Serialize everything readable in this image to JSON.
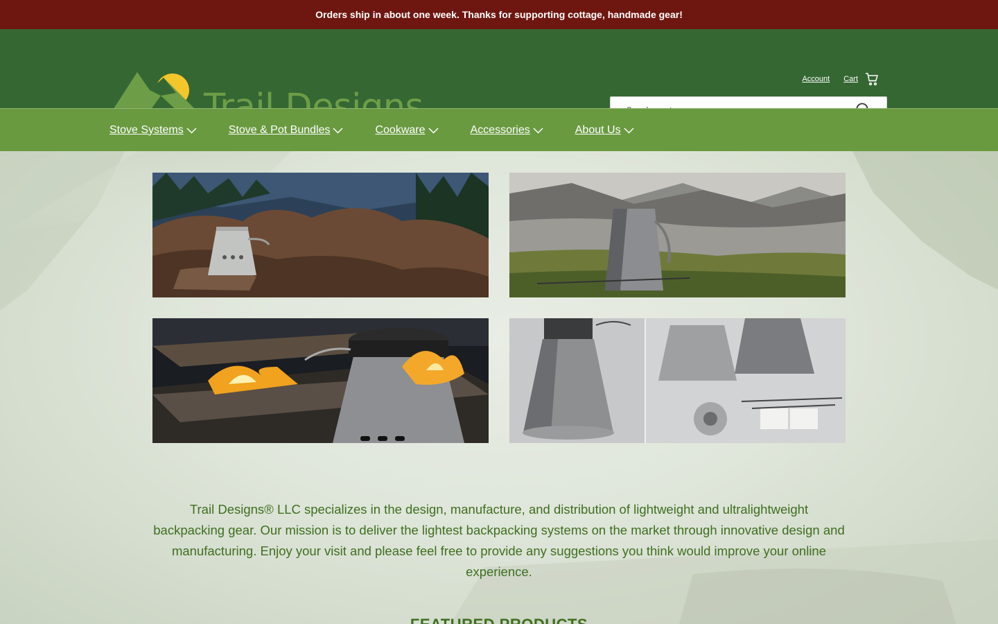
{
  "announcement": "Orders ship in about one week. Thanks for supporting cottage, handmade gear!",
  "brand": {
    "name": "Trail Designs",
    "accent": "#6d9e47",
    "sun": "#f3c62b"
  },
  "header": {
    "account_label": "Account",
    "cart_label": "Cart",
    "search_placeholder": "Search our store"
  },
  "nav": {
    "items": [
      {
        "label": "Stove Systems"
      },
      {
        "label": "Stove & Pot Bundles"
      },
      {
        "label": "Cookware"
      },
      {
        "label": "Accessories"
      },
      {
        "label": "About Us"
      }
    ]
  },
  "intro": "Trail Designs® LLC specializes in the design, manufacture, and distribution of lightweight and ultralightweight backpacking gear. Our mission is to deliver the lightest backpacking systems on the market through innovative design and manufacturing. Enjoy your visit and please feel free to provide any suggestions you think would improve your online experience.",
  "featured_heading": "FEATURED PRODUCTS",
  "colors": {
    "announcement_bg": "#6e1610",
    "header_bg": "#356733",
    "nav_bg": "#699a40",
    "text_green": "#3f6e1f"
  },
  "icons": [
    "cart-icon",
    "search-icon",
    "chevron-down-icon"
  ]
}
